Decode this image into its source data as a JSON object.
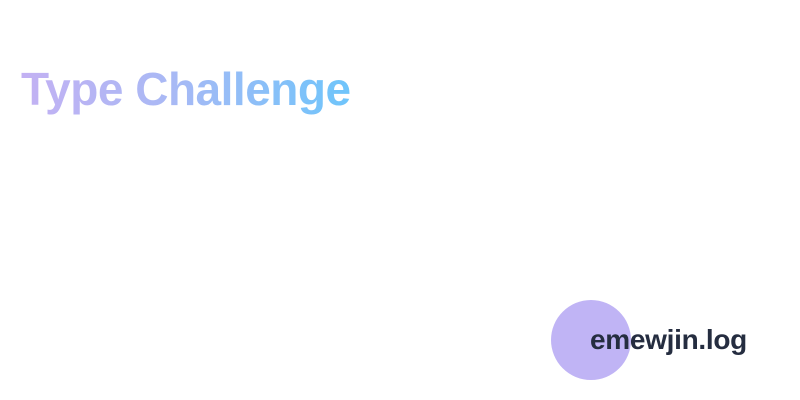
{
  "title": "Type Challenge",
  "brand": {
    "name": "emewjin.log",
    "logo_icon": "circle-logo-icon"
  },
  "colors": {
    "title_gradient_start": "#c3b1f3",
    "title_gradient_end": "#6ec5fb",
    "brand_circle": "#c0b4f5",
    "brand_text": "#252d40",
    "background": "#ffffff"
  }
}
